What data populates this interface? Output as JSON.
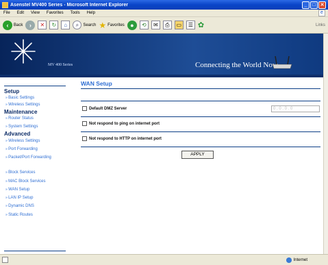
{
  "window": {
    "title": "Asenstel MV400 Series - Microsoft Internet Explorer"
  },
  "menu": {
    "items": [
      "File",
      "Edit",
      "View",
      "Favorites",
      "Tools",
      "Help"
    ]
  },
  "toolbar": {
    "back": "Back",
    "search": "Search",
    "favorites": "Favorites",
    "links": "Links"
  },
  "banner": {
    "model": "MV 400 Series",
    "tagline": "Connecting the World Now"
  },
  "sidebar": {
    "sections": [
      {
        "heading": "Setup",
        "items": [
          "Basic Settings",
          "Wireless Settings"
        ]
      },
      {
        "heading": "Maintenance",
        "items": [
          "Router Status",
          "System Settings"
        ]
      },
      {
        "heading": "Advanced",
        "items": [
          "Wireless Settings",
          "Port Forwarding",
          "Packet/Port Forwarding",
          "Block Services",
          "MAC Block Services",
          "WAN Setup",
          "LAN IP Setup",
          "Dynamic DNS",
          "Static Routes"
        ]
      }
    ]
  },
  "main": {
    "title": "WAN Setup",
    "options": {
      "dmz_label": "Default DMZ Server",
      "dmz_placeholder": "0 . 0 . 0 . 0",
      "ping_label": "Not respond to ping on internet port",
      "http_label": "Not respond to HTTP on internet port"
    },
    "apply_label": "APPLY"
  },
  "status": {
    "zone": "Internet"
  }
}
